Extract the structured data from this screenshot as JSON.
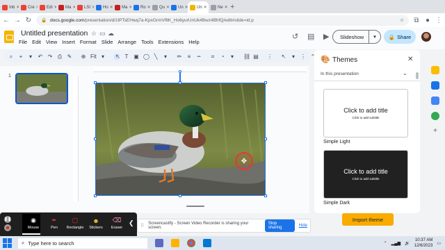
{
  "browser": {
    "tabs": [
      {
        "label": "Inb",
        "color": "#ea4335"
      },
      {
        "label": "Cre",
        "color": "#ea4335"
      },
      {
        "label": "Edi",
        "color": "#ea4335"
      },
      {
        "label": "Ma",
        "color": "#c5221f"
      },
      {
        "label": "LSI",
        "color": "#ea4335"
      },
      {
        "label": "Ho",
        "color": "#1a73e8"
      },
      {
        "label": "Ma",
        "color": "#c5221f"
      },
      {
        "label": "Ro",
        "color": "#1a73e8"
      },
      {
        "label": "Qu",
        "color": "#9aa0a6"
      },
      {
        "label": "Un",
        "color": "#1a73e8"
      },
      {
        "label": "Un",
        "color": "#f4b400"
      },
      {
        "label": "Ne",
        "color": "#9aa0a6"
      }
    ],
    "active_tab_index": 10,
    "url_host": "docs.google.com",
    "url_path": "/presentation/d/1lPTsEHwq7a-KpxGrmVfltK_Ho6yurUnUk4Bwz4BhfQ/edit#slide=id.p"
  },
  "doc": {
    "title": "Untitled presentation",
    "menu": [
      "File",
      "Edit",
      "View",
      "Insert",
      "Format",
      "Slide",
      "Arrange",
      "Tools",
      "Extensions",
      "Help"
    ],
    "slideshow_label": "Slideshow",
    "share_label": "Share"
  },
  "toolbar": {
    "zoom": "Fit"
  },
  "filmstrip": {
    "slide_number": "1"
  },
  "themes": {
    "title": "Themes",
    "filter": "In this presentation",
    "cards": [
      {
        "name": "Simple Light",
        "title": "Click to add title",
        "subtitle": "Click to add subtitle",
        "bg": "#ffffff",
        "fg": "#202124"
      },
      {
        "name": "Simple Dark",
        "title": "Click to add title",
        "subtitle": "Click to add subtitle",
        "bg": "#212121",
        "fg": "#ffffff"
      }
    ],
    "import_label": "Import theme"
  },
  "screencastify": {
    "tools": [
      {
        "label": "Mouse",
        "icon": "mouse-icon"
      },
      {
        "label": "Pen",
        "icon": "pen-icon"
      },
      {
        "label": "Rectangle",
        "icon": "rectangle-icon"
      },
      {
        "label": "Stickers",
        "icon": "sticker-icon"
      },
      {
        "label": "Eraser",
        "icon": "eraser-icon"
      }
    ],
    "share_message": "Screencastify - Screen Video Recorder is sharing your screen.",
    "stop_sharing_label": "Stop sharing",
    "hide_label": "Hide"
  },
  "taskbar": {
    "search_placeholder": "Type here to search",
    "time": "10:37 AM",
    "date": "12/6/2023"
  },
  "colors": {
    "accent": "#1a73e8",
    "share_bg": "#c2e7ff",
    "import_bg": "#f9ab00"
  }
}
